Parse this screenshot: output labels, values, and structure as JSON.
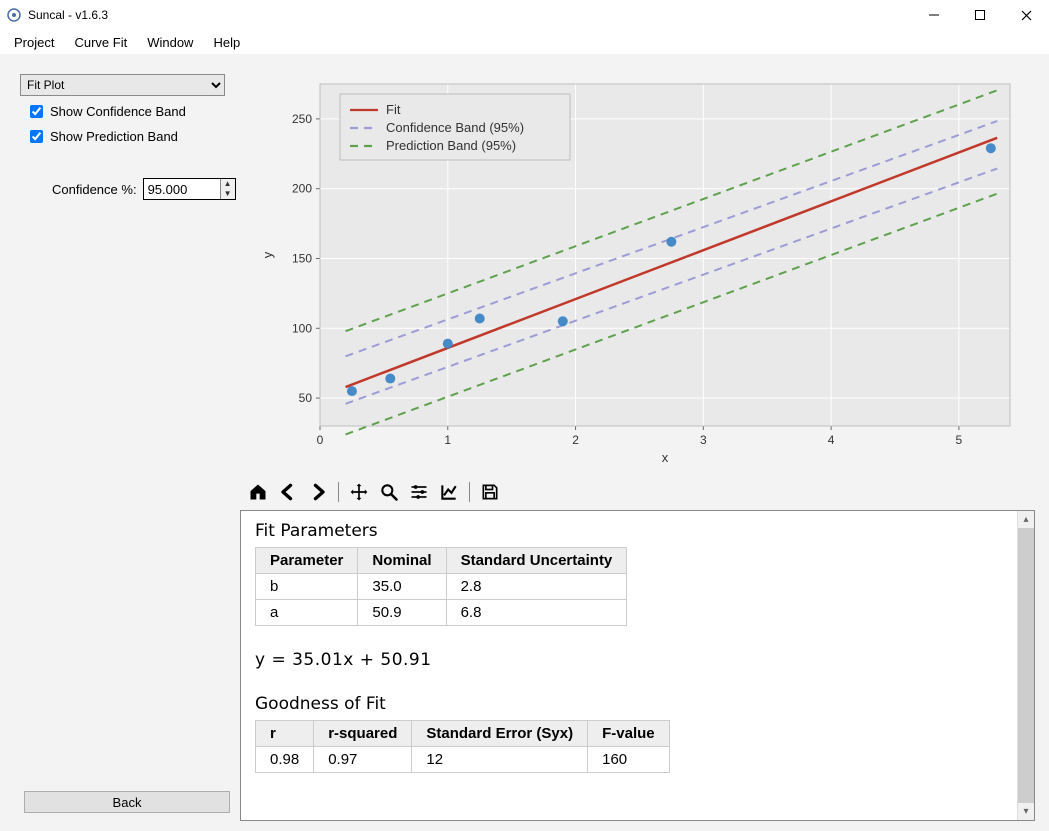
{
  "window": {
    "title": "Suncal - v1.6.3"
  },
  "menu": {
    "items": [
      "Project",
      "Curve Fit",
      "Window",
      "Help"
    ]
  },
  "sidebar": {
    "dropdown_value": "Fit Plot",
    "chk_confidence_label": "Show Confidence Band",
    "chk_prediction_label": "Show Prediction Band",
    "confidence_label": "Confidence %:",
    "confidence_value": "95.000",
    "back_label": "Back"
  },
  "toolbar": {
    "home": "home-icon",
    "back": "arrow-left-icon",
    "forward": "arrow-right-icon",
    "pan": "move-icon",
    "zoom": "zoom-icon",
    "subplots": "sliders-icon",
    "axes": "axes-icon",
    "save": "save-icon"
  },
  "results": {
    "fit_params_title": "Fit Parameters",
    "params_table": {
      "headers": [
        "Parameter",
        "Nominal",
        "Standard Uncertainty"
      ],
      "rows": [
        [
          "b",
          "35.0",
          "2.8"
        ],
        [
          "a",
          "50.9",
          "6.8"
        ]
      ]
    },
    "equation": "y = 35.01x + 50.91",
    "gof_title": "Goodness of Fit",
    "gof_table": {
      "headers": [
        "r",
        "r-squared",
        "Standard Error (Syx)",
        "F-value"
      ],
      "rows": [
        [
          "0.98",
          "0.97",
          "12",
          "160"
        ]
      ]
    }
  },
  "chart_data": {
    "type": "scatter",
    "title": "",
    "xlabel": "x",
    "ylabel": "y",
    "xlim": [
      0,
      5.4
    ],
    "ylim": [
      30,
      275
    ],
    "xticks": [
      0,
      1,
      2,
      3,
      4,
      5
    ],
    "yticks": [
      50,
      100,
      150,
      200,
      250
    ],
    "series": [
      {
        "name": "Fit",
        "type": "line",
        "color": "#c0392b",
        "dash": "solid",
        "slope": 35.01,
        "intercept": 50.91
      },
      {
        "name": "Confidence Band (95%)",
        "type": "band",
        "color": "#9d9cd6",
        "dash": "dashed",
        "offsets_at_xlim": {
          "lower_start": -12,
          "lower_end": -22,
          "upper_start": 22,
          "upper_end": 12
        }
      },
      {
        "name": "Prediction Band (95%)",
        "type": "band",
        "color": "#5fa24e",
        "dash": "dashed",
        "offsets_at_xlim": {
          "lower_start": -34,
          "lower_end": -40,
          "upper_start": 40,
          "upper_end": 34
        }
      }
    ],
    "points": {
      "name": "data",
      "color": "#3d86c6",
      "x": [
        0.25,
        0.55,
        1.0,
        1.25,
        1.9,
        2.75,
        5.25
      ],
      "y": [
        55,
        64,
        89,
        107,
        105,
        162,
        229
      ]
    },
    "legend": {
      "position": "upper-left-inside",
      "entries": [
        "Fit",
        "Confidence Band (95%)",
        "Prediction Band (95%)"
      ]
    }
  }
}
